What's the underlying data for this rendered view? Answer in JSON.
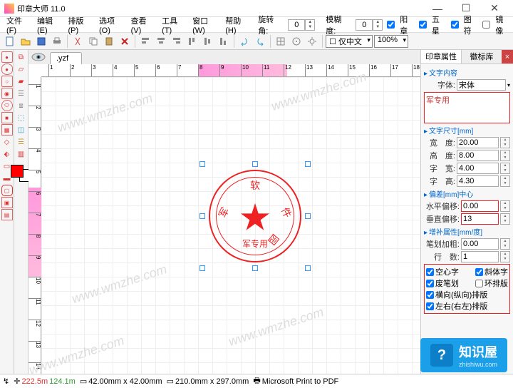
{
  "app_title": "印章大师 11.0",
  "menu": [
    "文件(F)",
    "编辑(E)",
    "排版(P)",
    "选项(O)",
    "查看(V)",
    "工具(T)",
    "窗口(W)",
    "帮助(H)"
  ],
  "menu2": {
    "rot_label": "旋转角:",
    "rot_val": "0",
    "blur_label": "模糊度:",
    "blur_val": "0"
  },
  "checks1": [
    "阳章",
    "五星",
    "图符",
    "镜像"
  ],
  "combo": {
    "cn_only": "仅中文",
    "zoom": "100%"
  },
  "tab": ".yzf",
  "seal": {
    "chars": [
      "软",
      "件",
      "园",
      "军"
    ],
    "bottom": "军专用"
  },
  "panel": {
    "tabs": [
      "印章属性",
      "徽标库"
    ],
    "sect1": "文字内容",
    "font_label": "字体:",
    "font_val": "宋体",
    "big_text": "军专用",
    "sect2": "文字尺寸[mm]",
    "w_label": "宽　度:",
    "w_val": "20.00",
    "h_label": "高　度:",
    "h_val": "8.00",
    "cw_label": "字　宽:",
    "cw_val": "4.00",
    "ch_label": "字　高:",
    "ch_val": "4.30",
    "sect3": "偏差[mm]中心",
    "hoff_label": "水平偏移:",
    "hoff_val": "0.00",
    "voff_label": "垂直偏移:",
    "voff_val": "13",
    "sect4": "增补属性[mm/度]",
    "bold_label": "笔划加粗:",
    "bold_val": "0.00",
    "lines_label": "行　数:",
    "lines_val": "1",
    "c1": "空心字",
    "c2": "斜体字",
    "c3": "废笔划",
    "c4": "环排版",
    "c5": "横向(纵向)排版",
    "c6": "左右(右左)排版"
  },
  "status": {
    "x": "222.5m",
    "y": "124.1m",
    "sel": "42.00mm x 42.00mm",
    "page": "210.0mm x 297.0mm",
    "printer": "Microsoft Print to PDF"
  },
  "brand": {
    "name": "知识屋",
    "url": "zhishiwu.com"
  },
  "hticks": [
    "1",
    "2",
    "3",
    "4",
    "5",
    "6",
    "7",
    "8",
    "9",
    "10",
    "11",
    "12",
    "13",
    "14",
    "15",
    "16",
    "17",
    "18"
  ],
  "vticks": [
    "1",
    "2",
    "3",
    "4",
    "5",
    "6",
    "7",
    "8",
    "9",
    "10",
    "11",
    "12",
    "13",
    "14"
  ]
}
